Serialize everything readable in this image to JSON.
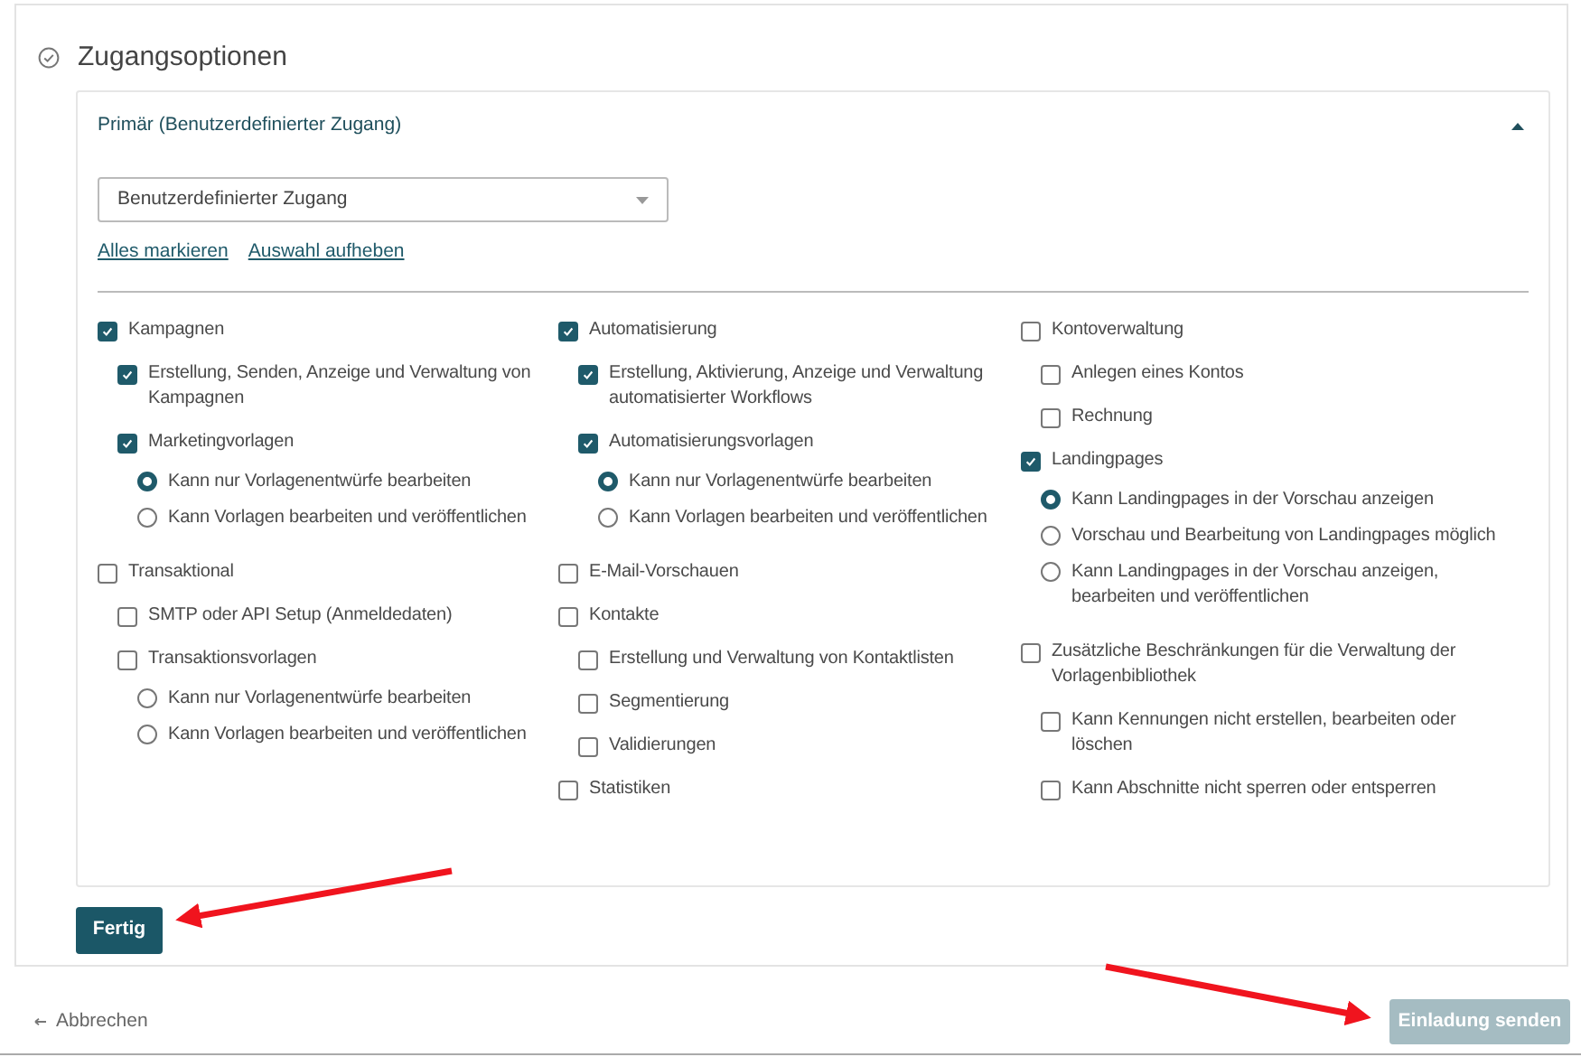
{
  "section": {
    "title": "Zugangsoptionen"
  },
  "panel": {
    "title": "Primär (Benutzerdefinierter Zugang)",
    "expanded": true,
    "dropdown": {
      "value": "Benutzerdefinierter Zugang"
    },
    "links": [
      "Alles markieren",
      "Auswahl aufheben"
    ],
    "columns": [
      {
        "items": [
          {
            "kind": "checkbox",
            "label": "Kampagnen",
            "checked": true,
            "children": [
              {
                "kind": "checkbox",
                "label": "Erstellung, Senden, Anzeige und Verwaltung von Kampagnen",
                "checked": true
              },
              {
                "kind": "checkbox",
                "label": "Marketingvorlagen",
                "checked": true,
                "children": [
                  {
                    "kind": "radio",
                    "label": "Kann nur Vorlagenentwürfe bearbeiten",
                    "selected": true
                  },
                  {
                    "kind": "radio",
                    "label": "Kann Vorlagen bearbeiten und veröffentlichen",
                    "selected": false
                  }
                ]
              }
            ]
          },
          {
            "kind": "checkbox",
            "label": "Transaktional",
            "checked": false,
            "children": [
              {
                "kind": "checkbox",
                "label": "SMTP oder API Setup (Anmeldedaten)",
                "checked": false
              },
              {
                "kind": "checkbox",
                "label": "Transaktionsvorlagen",
                "checked": false,
                "children": [
                  {
                    "kind": "radio",
                    "label": "Kann nur Vorlagenentwürfe bearbeiten",
                    "selected": false
                  },
                  {
                    "kind": "radio",
                    "label": "Kann Vorlagen bearbeiten und veröffentlichen",
                    "selected": false
                  }
                ]
              }
            ]
          }
        ]
      },
      {
        "items": [
          {
            "kind": "checkbox",
            "label": "Automatisierung",
            "checked": true,
            "children": [
              {
                "kind": "checkbox",
                "label": "Erstellung, Aktivierung, Anzeige und Verwaltung automatisierter Workflows",
                "checked": true
              },
              {
                "kind": "checkbox",
                "label": "Automatisierungsvorlagen",
                "checked": true,
                "children": [
                  {
                    "kind": "radio",
                    "label": "Kann nur Vorlagenentwürfe bearbeiten",
                    "selected": true
                  },
                  {
                    "kind": "radio",
                    "label": "Kann Vorlagen bearbeiten und veröffentlichen",
                    "selected": false
                  }
                ]
              }
            ]
          },
          {
            "kind": "checkbox",
            "label": "E-Mail-Vorschauen",
            "checked": false
          },
          {
            "kind": "checkbox",
            "label": "Kontakte",
            "checked": false,
            "children": [
              {
                "kind": "checkbox",
                "label": "Erstellung und Verwaltung von Kontaktlisten",
                "checked": false
              },
              {
                "kind": "checkbox",
                "label": "Segmentierung",
                "checked": false
              },
              {
                "kind": "checkbox",
                "label": "Validierungen",
                "checked": false
              }
            ]
          },
          {
            "kind": "checkbox",
            "label": "Statistiken",
            "checked": false
          }
        ]
      },
      {
        "items": [
          {
            "kind": "checkbox",
            "label": "Kontoverwaltung",
            "checked": false,
            "children": [
              {
                "kind": "checkbox",
                "label": "Anlegen eines Kontos",
                "checked": false
              },
              {
                "kind": "checkbox",
                "label": "Rechnung",
                "checked": false
              }
            ]
          },
          {
            "kind": "checkbox",
            "label": "Landingpages",
            "checked": true,
            "children": [
              {
                "kind": "radio",
                "label": "Kann Landingpages in der Vorschau anzeigen",
                "selected": true
              },
              {
                "kind": "radio",
                "label": "Vorschau und Bearbeitung von Landingpages möglich",
                "selected": false
              },
              {
                "kind": "radio",
                "label": "Kann Landingpages in der Vorschau anzeigen, bearbeiten und veröffentlichen",
                "selected": false
              }
            ]
          },
          {
            "kind": "checkbox",
            "label": "Zusätzliche Beschränkungen für die Verwaltung der Vorlagenbibliothek",
            "checked": false,
            "children": [
              {
                "kind": "checkbox",
                "label": "Kann Kennungen nicht erstellen, bearbeiten oder löschen",
                "checked": false
              },
              {
                "kind": "checkbox",
                "label": "Kann Abschnitte nicht sperren oder entsperren",
                "checked": false
              }
            ]
          }
        ]
      }
    ]
  },
  "done_button": "Fertig",
  "cancel_link": "Abbrechen",
  "send_button": {
    "label": "Einladung senden",
    "disabled": true
  }
}
